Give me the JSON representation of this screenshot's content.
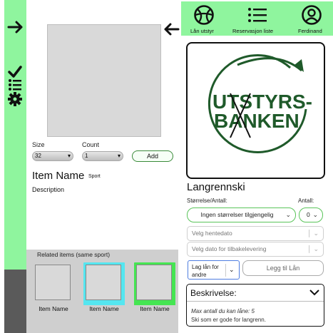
{
  "left_panel": {
    "size_label": "Size",
    "count_label": "Count",
    "size_value": "32",
    "count_value": "1",
    "add_label": "Add",
    "item_name": "Item Name",
    "item_sport": "Sport",
    "description": "Description",
    "related_title": "Related items (same sport)",
    "related_items": [
      {
        "name": "Item Name",
        "accent": "#d9d9d9"
      },
      {
        "name": "Item Name",
        "accent": "#55e6f0"
      },
      {
        "name": "Item Name",
        "accent": "#45e552"
      }
    ]
  },
  "topnav": {
    "items": [
      {
        "label": "Lån utstyr",
        "icon": "sports-ball-icon"
      },
      {
        "label": "Reservasjon liste",
        "icon": "list-icon"
      },
      {
        "label": "Ferdinand",
        "icon": "user-icon"
      }
    ]
  },
  "logo": {
    "line1": "UTSTYRS-",
    "line2": "BANKEN"
  },
  "product": {
    "title": "Langrennski",
    "size_label": "Størrelse/Antall:",
    "amount_label": "Antall:",
    "size_select": "Ingen størrelser tilgjengelig",
    "amount_select": "0",
    "pickup_placeholder": "Velg hentedato",
    "return_placeholder": "Velg dato for tilbakelevering",
    "loan_for_others": "Lag lån for andre",
    "add_loan": "Legg til Lån",
    "desc_title": "Beskrivelse:",
    "max_text": "Max antall du kan låne: 5",
    "desc_text": "Ski som er gode for langrenn."
  },
  "colors": {
    "accent": "#8ff59e",
    "brand_green": "#1f5a2a",
    "border_green": "#5ac45a"
  }
}
